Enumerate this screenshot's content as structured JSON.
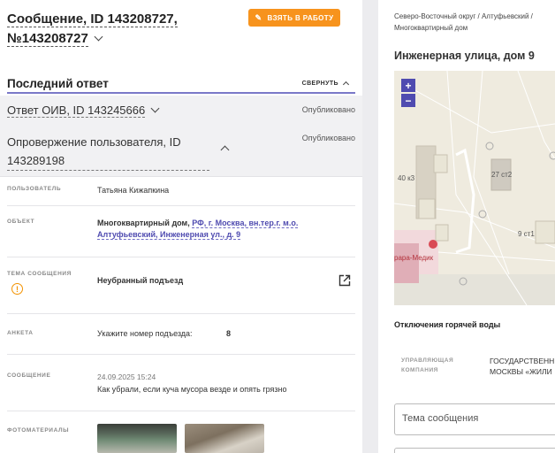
{
  "ticket": {
    "title_line1": "Сообщение, ID 143208727,",
    "title_line2": "№143208727",
    "take_button": "ВЗЯТЬ В РАБОТУ"
  },
  "last_answer": {
    "heading": "Последний ответ",
    "collapse_label": "СВЕРНУТЬ",
    "items": [
      {
        "title": "Ответ ОИВ, ID 143245666",
        "status": "Опубликовано"
      },
      {
        "title_line1": "Опровержение пользователя, ID",
        "title_line2": "143289198",
        "status": "Опубликовано"
      }
    ]
  },
  "details": {
    "user_label": "ПОЛЬЗОВАТЕЛЬ",
    "user_value": "Татьяна Кижапкина",
    "object_label": "ОБЪЕКТ",
    "object_type": "Многоквартирный дом,",
    "object_link_line1": "РФ, г. Москва, вн.тер.г. м.о.",
    "object_link_line2": "Алтуфьевский, Инженерная ул., д. 9",
    "topic_label_line1": "ТЕМА СООБЩЕНИЯ",
    "topic_value": "Неубранный подъезд",
    "form_label": "АНКЕТА",
    "form_question": "Укажите номер подъезда:",
    "form_answer": "8",
    "message_label": "СООБЩЕНИЕ",
    "message_date": "24.09.2025 15:24",
    "message_text": "Как убрали, если куча мусора везде и опять грязно",
    "photos_label": "ФОТОМАТЕРИАЛЫ"
  },
  "side": {
    "breadcrumb_line1": "Северо-Восточный округ / Алтуфьевский /",
    "breadcrumb_line2": "Многоквартирный дом",
    "address": "Инженерная улица, дом 9",
    "map": {
      "zoom_in": "+",
      "zoom_out": "−",
      "labels": [
        "40 к3",
        "27 ст2",
        "9 ст1",
        "рара-Медик"
      ]
    },
    "outage": "Отключения горячей воды",
    "uk_label_line1": "УПРАВЛЯЮЩАЯ",
    "uk_label_line2": "КОМПАНИЯ",
    "uk_value_line1": "ГОСУДАРСТВЕНН",
    "uk_value_line2": "МОСКВЫ «ЖИЛИ",
    "topic_input_placeholder": "Тема сообщения"
  },
  "colors": {
    "accent": "#4f4bb0",
    "orange": "#f7931d"
  }
}
